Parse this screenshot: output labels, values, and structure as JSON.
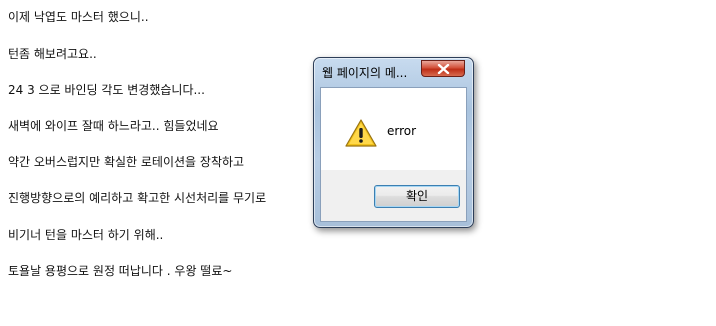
{
  "post": {
    "lines": [
      "이제 낙엽도 마스터 했으니..",
      "턴좀 해보려고요..",
      "24 3 으로 바인딩 각도 변경했습니다...",
      "새벽에 와이프 잘때 하느라고.. 힘들었네요",
      "약간 오버스럽지만 확실한 로테이션을 장착하고",
      "진행방향으로의 예리하고 확고한 시선처리를 무기로",
      "비기너 턴을 마스터 하기 위해..",
      "토욜날 용평으로 원정 떠납니다 . 우왕 떨료~"
    ]
  },
  "dialog": {
    "title": "웹 페이지의 메...",
    "message": "error",
    "ok_label": "확인",
    "icon": "warning-icon",
    "colors": {
      "close_button": "#c8452f",
      "ok_border": "#3c7fb1",
      "frame": "#b3cae3"
    }
  }
}
